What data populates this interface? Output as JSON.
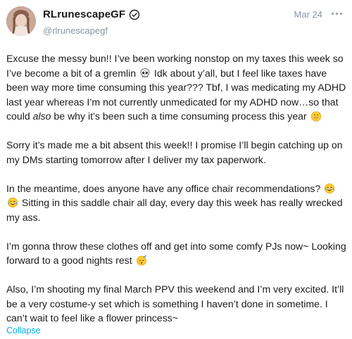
{
  "post": {
    "display_name": "RLrunescapeGF",
    "handle": "@rlrunescapegf",
    "date": "Mar 24",
    "verified_icon": "verified-check-icon",
    "more_icon": "more-options-icon",
    "paragraphs": [
      {
        "segments": [
          {
            "text": "Excuse the messy bun!! I’ve been working nonstop on my taxes this week so I’ve become a bit of a gremlin "
          },
          {
            "emoji": "skull-emoji"
          },
          {
            "text": " Idk about y’all, but I feel like taxes have been way more time consuming this year??? Tbf, I was medicating my ADHD last year whereas I’m not currently unmedicated for my ADHD now…so that could "
          },
          {
            "italic": "also"
          },
          {
            "text": " be why it’s been such a time consuming process this year "
          },
          {
            "emoji": "grimacing-sweat-emoji"
          }
        ]
      },
      {
        "segments": [
          {
            "text": "Sorry it’s made me a bit absent this week!! I promise I’ll begin catching up on my DMs starting tomorrow after I deliver my tax paperwork."
          }
        ]
      },
      {
        "segments": [
          {
            "text": "In the meantime, does anyone have any office chair recommendations? "
          },
          {
            "emoji": "tears-of-joy-emoji"
          },
          {
            "emoji": "tears-of-joy-emoji"
          },
          {
            "text": " Sitting in this saddle chair all day, every day this week has really wrecked my ass."
          }
        ]
      },
      {
        "segments": [
          {
            "text": "I’m gonna throw these clothes off and get into some comfy PJs now~ Looking forward to a good nights rest "
          },
          {
            "emoji": "sleeping-emoji"
          }
        ]
      },
      {
        "segments": [
          {
            "text": "Also, I’m shooting my final March PPV this weekend and I’m very excited. It’ll be a very costume-y set which is something I haven’t done in sometime. I can’t wait to feel like a flower princess~"
          }
        ]
      }
    ],
    "collapse_label": "Collapse",
    "colors": {
      "accent": "#00aff0",
      "muted": "#8a96a3",
      "text": "#1b1b1b"
    }
  }
}
